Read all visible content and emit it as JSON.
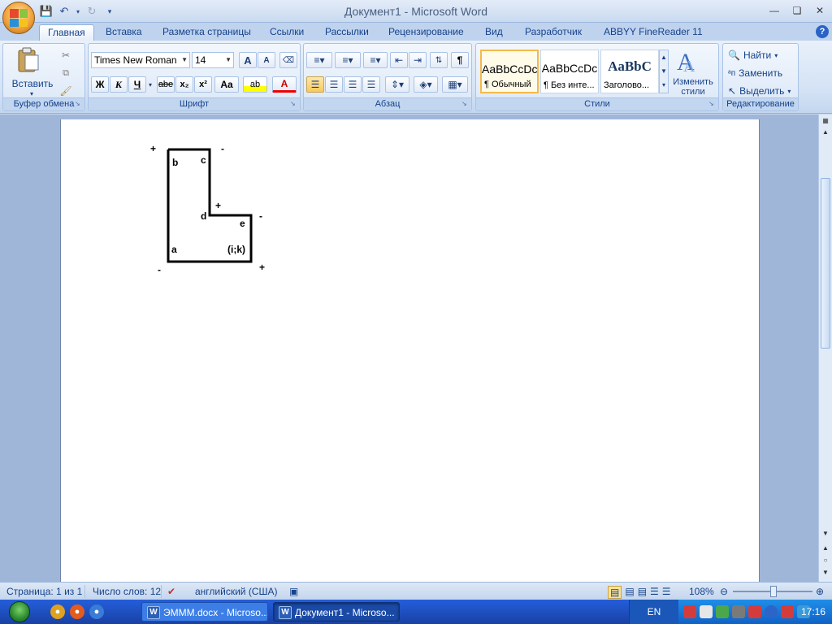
{
  "window": {
    "title": "Документ1 - Microsoft Word"
  },
  "qat": {
    "save_icon": "save-icon",
    "undo_icon": "undo-icon",
    "redo_icon": "redo-icon",
    "customize_icon": "customize-icon"
  },
  "tabs": [
    {
      "label": "Главная",
      "active": true
    },
    {
      "label": "Вставка"
    },
    {
      "label": "Разметка страницы"
    },
    {
      "label": "Ссылки"
    },
    {
      "label": "Рассылки"
    },
    {
      "label": "Рецензирование"
    },
    {
      "label": "Вид"
    },
    {
      "label": "Разработчик"
    },
    {
      "label": "ABBYY FineReader 11"
    }
  ],
  "ribbon": {
    "clipboard": {
      "label": "Буфер обмена",
      "paste": "Вставить"
    },
    "font": {
      "label": "Шрифт",
      "name": "Times New Roman",
      "size": "14",
      "bold": "Ж",
      "italic": "К",
      "underline": "Ч",
      "strike": "abe",
      "subscript": "x₂",
      "superscript": "x²",
      "case": "Aa",
      "grow": "A",
      "shrink": "A",
      "highlight": "ab",
      "color": "A"
    },
    "paragraph": {
      "label": "Абзац",
      "pilcrow": "¶"
    },
    "styles": {
      "label": "Стили",
      "items": [
        {
          "sample": "AaBbCcDc",
          "name": "¶ Обычный",
          "selected": true
        },
        {
          "sample": "AaBbCcDc",
          "name": "¶ Без инте..."
        },
        {
          "sample": "AaBbC",
          "name": "Заголово..."
        }
      ],
      "change": "Изменить",
      "change2": "стили"
    },
    "editing": {
      "label": "Редактирование",
      "find": "Найти",
      "replace": "Заменить",
      "select": "Выделить"
    }
  },
  "document": {
    "labels": {
      "plus_tl": "+",
      "minus_tr": "-",
      "b": "b",
      "c": "c",
      "plus_mid": "+",
      "d": "d",
      "e": "e",
      "minus_right": "-",
      "a": "a",
      "ik": "(i;k)",
      "minus_bl": "-",
      "plus_br": "+"
    }
  },
  "status": {
    "page": "Страница: 1 из 1",
    "words": "Число слов: 12",
    "language": "английский (США)",
    "zoom": "108%",
    "zoom_value": 108
  },
  "taskbar": {
    "items": [
      {
        "label": "ЭМММ.docx - Microso..."
      },
      {
        "label": "Документ1 - Microso...",
        "active": true
      }
    ],
    "lang": "EN",
    "clock": "17:16"
  }
}
